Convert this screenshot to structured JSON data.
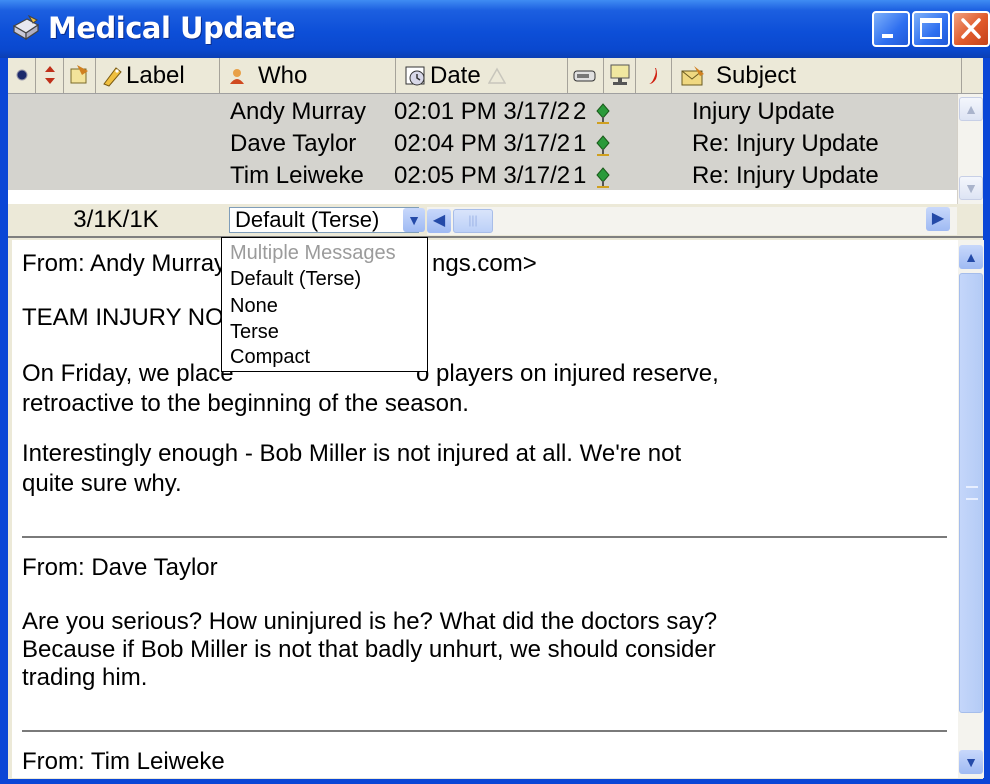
{
  "window": {
    "title": "Medical Update"
  },
  "columns": {
    "label": "Label",
    "who": "Who",
    "date": "Date",
    "subject": "Subject"
  },
  "messages": [
    {
      "who": "Andy Murray",
      "date": "02:01 PM 3/17/2",
      "count": "2",
      "subject": "Injury Update"
    },
    {
      "who": "Dave Taylor",
      "date": "02:04 PM 3/17/2",
      "count": "1",
      "subject": "Re: Injury Update"
    },
    {
      "who": "Tim Leiweke",
      "date": "02:05 PM 3/17/2",
      "count": "1",
      "subject": "Re: Injury Update"
    }
  ],
  "status": {
    "counts": "3/1K/1K",
    "view_mode": "Default (Terse)"
  },
  "view_dropdown": {
    "options": [
      "Multiple Messages",
      "Default (Terse)",
      "None",
      "Terse",
      "Compact"
    ]
  },
  "body": {
    "line1_from": "From: Andy Murray",
    "line1_email_tail": "ngs.com>",
    "line2": "TEAM INJURY NOT",
    "line3_a": "On Friday, we place",
    "line3_b": "o players on injured reserve,",
    "line4": "retroactive to the beginning of the season.",
    "line5": "Interestingly enough - Bob Miller is not injured at all.  We're not",
    "line6": "quite sure why.",
    "from2": "From: Dave Taylor",
    "line7": "Are you serious?  How uninjured is he?  What did the doctors say?",
    "line8": "Because if Bob Miller is not that badly unhurt, we should consider",
    "line9": "trading him.",
    "from3": "From: Tim Leiweke"
  },
  "colors": {
    "titlebar": "#0a46d6",
    "list_background": "#d4d3ce",
    "scroll_blue": "#b4cbf6"
  }
}
